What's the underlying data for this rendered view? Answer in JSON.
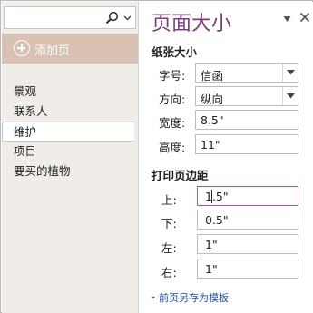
{
  "sidebar": {
    "search": {
      "placeholder": ""
    },
    "add_page_label": "添加页",
    "pages": [
      {
        "label": "景观",
        "selected": false
      },
      {
        "label": "联系人",
        "selected": false
      },
      {
        "label": "维护",
        "selected": true
      },
      {
        "label": "项目",
        "selected": false
      },
      {
        "label": "要买的植物",
        "selected": false
      }
    ]
  },
  "panel": {
    "title": "页面大小",
    "paper_section": {
      "title": "纸张大小",
      "size": {
        "label": "字号:",
        "value": "信函"
      },
      "orientation": {
        "label": "方向:",
        "value": "纵向"
      },
      "width": {
        "label": "宽度:",
        "value": "8.5\""
      },
      "height": {
        "label": "高度:",
        "value": "11\""
      }
    },
    "margin_section": {
      "title": "打印页边距",
      "top": {
        "label": "上:",
        "value": "1.5\""
      },
      "bottom": {
        "label": "下:",
        "value": "0.5\""
      },
      "left": {
        "label": "左:",
        "value": "1\""
      },
      "right": {
        "label": "右:",
        "value": "1\""
      }
    },
    "save_template_label": "前页另存为模板"
  },
  "colors": {
    "accent": "#7b3c7c",
    "add_page_bg": "#d9c1b3",
    "sidebar_bg": "#f0ede8",
    "link": "#1a4fa0"
  }
}
